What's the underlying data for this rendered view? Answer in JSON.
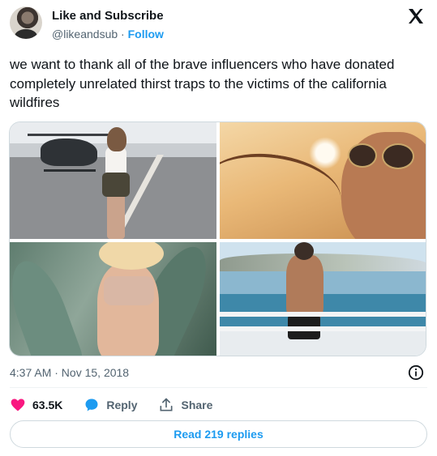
{
  "author": {
    "display_name": "Like and Subscribe",
    "handle": "@likeandsub",
    "separator": "·",
    "follow_label": "Follow"
  },
  "tweet": {
    "text": "we want to thank all of the brave influencers who have donated completely unrelated thirst traps to the victims of the california wildfires",
    "timestamp": "4:37 AM · Nov 15, 2018"
  },
  "media": [
    {
      "name": "photo-helicopter-woman",
      "icon": "photo"
    },
    {
      "name": "photo-sunglasses-selfie",
      "icon": "photo"
    },
    {
      "name": "photo-agave-woman",
      "icon": "photo"
    },
    {
      "name": "photo-shirtless-man-pier",
      "icon": "photo"
    }
  ],
  "actions": {
    "like_count": "63.5K",
    "reply_label": "Reply",
    "share_label": "Share"
  },
  "read_replies_label": "Read 219 replies",
  "colors": {
    "accent": "#1d9bf0",
    "like": "#f91880",
    "text": "#0f1419",
    "muted": "#536471"
  },
  "icons": [
    "x-logo-icon",
    "info-icon",
    "heart-icon",
    "reply-bubble-icon",
    "share-icon"
  ]
}
